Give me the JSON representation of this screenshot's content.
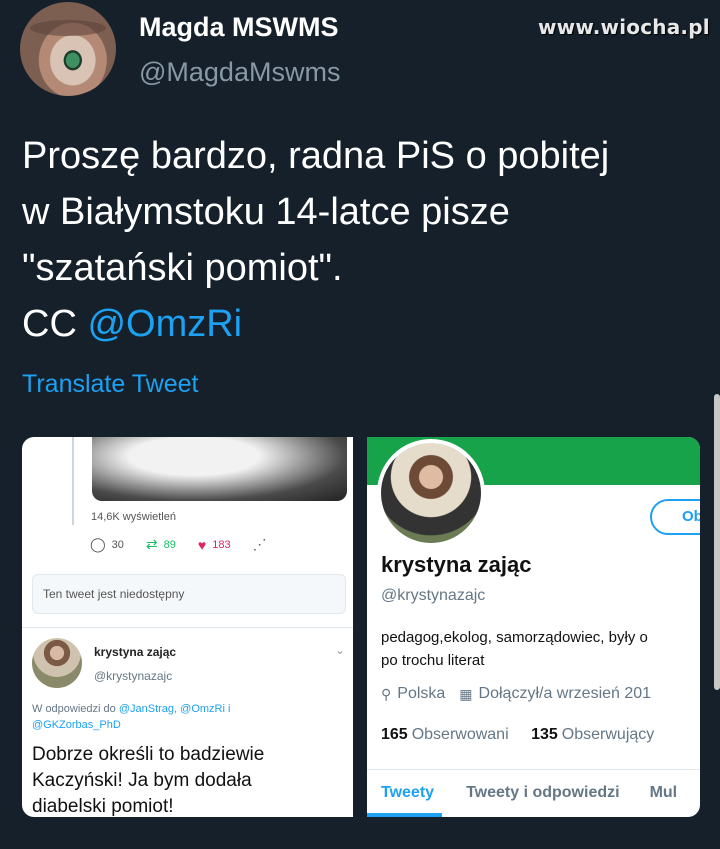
{
  "tweet": {
    "author_name": "Magda MSWMS",
    "author_handle": "@MagdaMswms",
    "watermark": "www.wiocha.pl",
    "text_lines": [
      "Proszę bardzo, radna PiS o pobitej",
      "w Białymstoku 14-latce pisze",
      "\"szatański pomiot\"."
    ],
    "cc_prefix": "CC",
    "cc_mention": "@OmzRi",
    "translate_label": "Translate Tweet"
  },
  "left_image": {
    "views": "14,6K wyświetleń",
    "replies": "30",
    "retweets": "89",
    "likes": "183",
    "unavailable_text": "Ten tweet jest niedostępny",
    "reply_name": "krystyna zając",
    "reply_handle": "@krystynazajc",
    "reply_to_prefix": "W odpowiedzi do",
    "reply_to_mentions": "@JanStrag, @OmzRi i",
    "reply_to_mentions_2": "@GKZorbas_PhD",
    "reply_body_lines": [
      "Dobrze określi to badziewie",
      "Kaczyński! Ja bym dodała",
      "diabelski pomiot!"
    ]
  },
  "right_image": {
    "follow_label": "Ob",
    "name": "krystyna zając",
    "handle": "@krystynazajc",
    "bio_lines": [
      "pedagog,ekolog, samorządowiec, były o",
      "po trochu literat"
    ],
    "location": "Polska",
    "joined": "Dołączył/a wrzesień 201",
    "following_count": "165",
    "following_label": "Obserwowani",
    "followers_count": "135",
    "followers_label": "Obserwujący",
    "tabs": [
      "Tweety",
      "Tweety i odpowiedzi",
      "Mul"
    ]
  },
  "colors": {
    "background": "#15202b",
    "link": "#1da1f2",
    "banner": "#17a34a"
  }
}
